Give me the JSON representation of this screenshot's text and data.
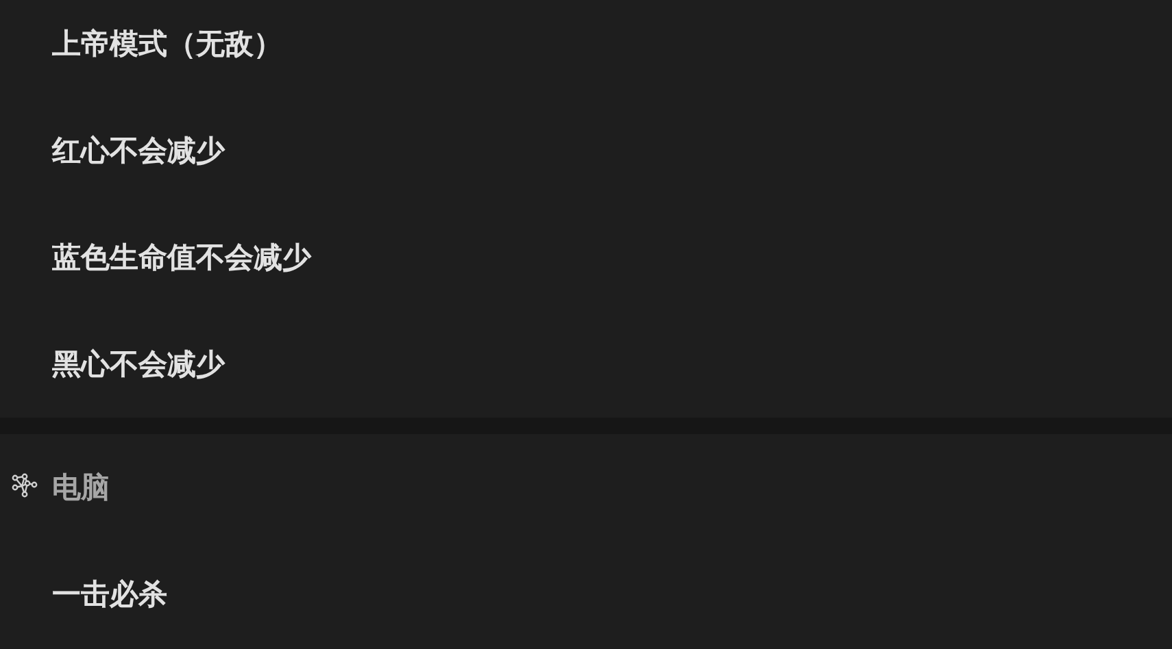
{
  "groups": [
    {
      "items": [
        {
          "label": "上帝模式（无敌）"
        },
        {
          "label": "红心不会减少"
        },
        {
          "label": "蓝色生命值不会减少"
        },
        {
          "label": "黑心不会减少"
        }
      ]
    },
    {
      "header": "电脑",
      "items": [
        {
          "label": "一击必杀"
        }
      ]
    }
  ]
}
